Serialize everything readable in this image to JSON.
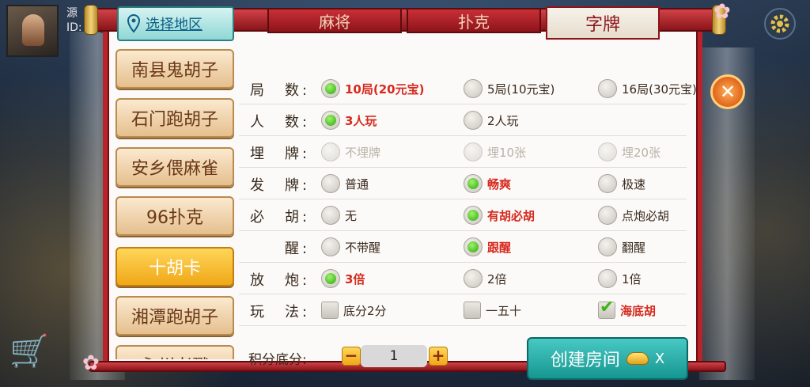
{
  "header": {
    "player_id_prefix": "ID:",
    "player_name_partial": "源"
  },
  "region_tab": {
    "label": "选择地区",
    "icon": "location-pin-icon"
  },
  "tabs": [
    {
      "label": "麻将",
      "active": false
    },
    {
      "label": "扑克",
      "active": false
    },
    {
      "label": "字牌",
      "active": true
    }
  ],
  "games": [
    {
      "label": "南县鬼胡子"
    },
    {
      "label": "石门跑胡子"
    },
    {
      "label": "安乡偎麻雀"
    },
    {
      "label": "96扑克"
    },
    {
      "label": "十胡卡",
      "active": true
    },
    {
      "label": "湘潭跑胡子"
    },
    {
      "label": "永州老戳"
    }
  ],
  "options": [
    {
      "label": "局　数:",
      "type": "radio",
      "choices": [
        {
          "text": "10局(20元宝)",
          "selected": true
        },
        {
          "text": "5局(10元宝)",
          "selected": false
        },
        {
          "text": "16局(30元宝)",
          "selected": false
        }
      ]
    },
    {
      "label": "人　数:",
      "type": "radio",
      "choices": [
        {
          "text": "3人玩",
          "selected": true
        },
        {
          "text": "2人玩",
          "selected": false
        }
      ]
    },
    {
      "label": "埋　牌:",
      "type": "radio",
      "disabled": true,
      "choices": [
        {
          "text": "不埋牌",
          "selected": false
        },
        {
          "text": "埋10张",
          "selected": false
        },
        {
          "text": "埋20张",
          "selected": false
        }
      ]
    },
    {
      "label": "发　牌:",
      "type": "radio",
      "choices": [
        {
          "text": "普通",
          "selected": false
        },
        {
          "text": "畅爽",
          "selected": true
        },
        {
          "text": "极速",
          "selected": false
        }
      ]
    },
    {
      "label": "必　胡:",
      "type": "radio",
      "choices": [
        {
          "text": "无",
          "selected": false
        },
        {
          "text": "有胡必胡",
          "selected": true
        },
        {
          "text": "点炮必胡",
          "selected": false
        }
      ]
    },
    {
      "label": "　　醒:",
      "type": "radio",
      "choices": [
        {
          "text": "不带醒",
          "selected": false
        },
        {
          "text": "跟醒",
          "selected": true,
          "highlight": true
        },
        {
          "text": "翻醒",
          "selected": false
        }
      ]
    },
    {
      "label": "放　炮:",
      "type": "radio",
      "choices": [
        {
          "text": "3倍",
          "selected": true
        },
        {
          "text": "2倍",
          "selected": false
        },
        {
          "text": "1倍",
          "selected": false
        }
      ]
    },
    {
      "label": "玩　法:",
      "type": "check",
      "choices": [
        {
          "text": "底分2分",
          "selected": false
        },
        {
          "text": "一五十",
          "selected": false
        },
        {
          "text": "海底胡",
          "selected": true
        }
      ]
    }
  ],
  "score": {
    "label": "积分底分:",
    "value": "1",
    "minus": "−",
    "plus": "+"
  },
  "create_button": {
    "label": "创建房间",
    "suffix": "X"
  },
  "close_button": {
    "label": "✕"
  },
  "icons": {
    "settings": "gear-icon",
    "cart": "cart-icon",
    "ingot": "gold-ingot-icon",
    "close": "close-icon"
  },
  "colors": {
    "accent_red": "#b9242a",
    "selected_text": "#d62a1e",
    "teal": "#169690",
    "gold": "#f0a817"
  }
}
